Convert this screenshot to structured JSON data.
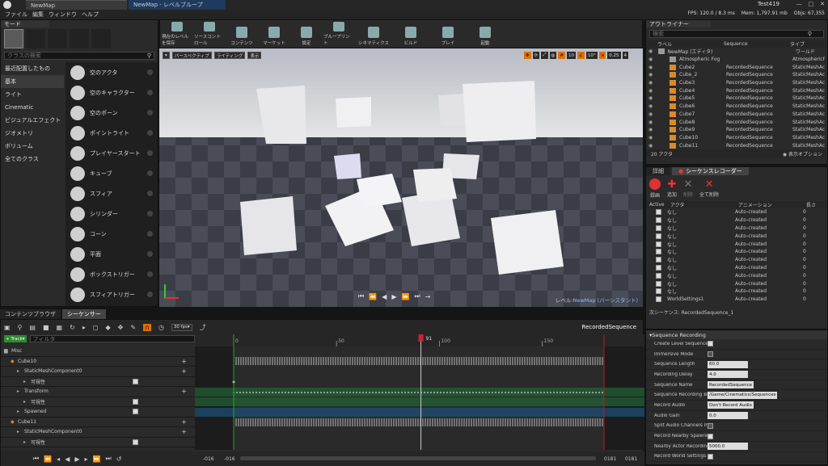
{
  "titlebar": {
    "tab1": "NewMap",
    "tab2": "NewMap - レベルブループ"
  },
  "menu": [
    "ファイル",
    "編集",
    "ウィンドウ",
    "ヘルプ"
  ],
  "stats": {
    "fps": "FPS: 120.0 / 8.3 ms",
    "mem": "Mem: 1,797.91 mb",
    "objs": "Objs: 67,355",
    "user": "Test419"
  },
  "modes": {
    "title": "モード",
    "search_placeholder": "クラスの検索",
    "categories": [
      "最近配置したもの",
      "基本",
      "ライト",
      "Cinematic",
      "ビジュアルエフェクト",
      "ジオメトリ",
      "ボリューム",
      "全てのクラス"
    ],
    "selected": 1,
    "items": [
      "空のアクタ",
      "空のキャラクター",
      "空のポーン",
      "ポイントライト",
      "プレイヤースタート",
      "キューブ",
      "スフィア",
      "シリンダー",
      "コーン",
      "平面",
      "ボックストリガー",
      "スフィアトリガー"
    ]
  },
  "toolbar": [
    "現在のレベルを保存",
    "ソースコントロール",
    "コンテンツ",
    "マーケット",
    "設定",
    "ブループリント",
    "シネマティクス",
    "ビルド",
    "プレイ",
    "起動"
  ],
  "viewport": {
    "perspective": "パースペクティブ",
    "lighting": "ライティング",
    "show": "表示",
    "grid": "10",
    "angle": "10°",
    "scale": "0.25",
    "cam": "4",
    "level_label": "レベル: ",
    "level_name": "NewMap (パーシスタント)"
  },
  "outliner": {
    "title": "アウトライナー",
    "search_placeholder": "検索",
    "cols": [
      "ラベル",
      "Sequence",
      "タイプ"
    ],
    "rows": [
      [
        "NewMap (エディタ)",
        "",
        "ワールド"
      ],
      [
        "Atmospheric Fog",
        "",
        "AtmosphericFog"
      ],
      [
        "Cube2",
        "RecordedSequence",
        "StaticMeshActor"
      ],
      [
        "Cube_2",
        "RecordedSequence",
        "StaticMeshActor"
      ],
      [
        "Cube3",
        "RecordedSequence",
        "StaticMeshActor"
      ],
      [
        "Cube4",
        "RecordedSequence",
        "StaticMeshActor"
      ],
      [
        "Cube5",
        "RecordedSequence",
        "StaticMeshActor"
      ],
      [
        "Cube6",
        "RecordedSequence",
        "StaticMeshActor"
      ],
      [
        "Cube7",
        "RecordedSequence",
        "StaticMeshActor"
      ],
      [
        "Cube8",
        "RecordedSequence",
        "StaticMeshActor"
      ],
      [
        "Cube9",
        "RecordedSequence",
        "StaticMeshActor"
      ],
      [
        "Cube10",
        "RecordedSequence",
        "StaticMeshActor"
      ],
      [
        "Cube11",
        "RecordedSequence",
        "StaticMeshActor"
      ]
    ],
    "count": "20 アクタ",
    "view_opts": "表示オプション"
  },
  "recorder": {
    "tab_details": "詳細",
    "tab_sr": "シーケンスレコーダー",
    "btns": [
      "録画",
      "追加",
      "削除",
      "全て削除"
    ],
    "cols": [
      "Active",
      "アクタ",
      "アニメーション",
      "長さ"
    ],
    "rows": [
      [
        "なし",
        "Auto-created",
        "0"
      ],
      [
        "なし",
        "Auto-created",
        "0"
      ],
      [
        "なし",
        "Auto-created",
        "0"
      ],
      [
        "なし",
        "Auto-created",
        "0"
      ],
      [
        "なし",
        "Auto-created",
        "0"
      ],
      [
        "なし",
        "Auto-created",
        "0"
      ],
      [
        "なし",
        "Auto-created",
        "0"
      ],
      [
        "なし",
        "Auto-created",
        "0"
      ],
      [
        "なし",
        "Auto-created",
        "0"
      ],
      [
        "なし",
        "Auto-created",
        "0"
      ],
      [
        "なし",
        "Auto-created",
        "0"
      ],
      [
        "WorldSettings1",
        "Auto-created",
        "0"
      ]
    ],
    "next": "次シーケンス: RecordedSequence_1"
  },
  "sr_props": {
    "section": "Sequence Recording",
    "items": [
      [
        "Create Level Sequence",
        "check"
      ],
      [
        "Immersive Mode",
        "uncheck"
      ],
      [
        "Sequence Length",
        "60.0"
      ],
      [
        "Recording Delay",
        "4.0"
      ],
      [
        "Sequence Name",
        "RecordedSequence"
      ],
      [
        "Sequence Recording Ba",
        "/Game/Cinematics/Sequences"
      ],
      [
        "Record Audio",
        "Don't Record Audio"
      ],
      [
        "Audio Gain",
        "0.0"
      ],
      [
        "Split Audio Channels Int",
        "uncheck"
      ],
      [
        "Record Nearby Spawned",
        "check"
      ],
      [
        "Nearby Actor Recording",
        "5000.0"
      ],
      [
        "Record World Settings A",
        "check"
      ]
    ]
  },
  "bottom_tabs": [
    "コンテンツブラウザ",
    "シーケンサー"
  ],
  "sequencer": {
    "fps": "30 fps",
    "name": "RecordedSequence",
    "track_btn": "+ Track",
    "filter_placeholder": "フィルタ",
    "frame": "91",
    "ticks": [
      "0",
      "50",
      "100",
      "150"
    ],
    "tracks": [
      [
        "Misc",
        0,
        "folder"
      ],
      [
        "Cube10",
        1,
        "actor"
      ],
      [
        "StaticMeshComponent0",
        2,
        "comp"
      ],
      [
        "可視性",
        3,
        "prop"
      ],
      [
        "Transform",
        2,
        "prop"
      ],
      [
        "可視性",
        3,
        "prop"
      ],
      [
        "Spawned",
        2,
        "prop"
      ],
      [
        "Cube11",
        1,
        "actor"
      ],
      [
        "StaticMeshComponent0",
        2,
        "comp"
      ],
      [
        "可視性",
        3,
        "prop"
      ]
    ],
    "range_left": "-016",
    "range_left2": "-016",
    "range_right": "0181",
    "range_right2": "0181"
  },
  "colors": {
    "accent": "#e07000",
    "select_blue": "#1e3a5e",
    "green_track": "#1f6f3a"
  }
}
